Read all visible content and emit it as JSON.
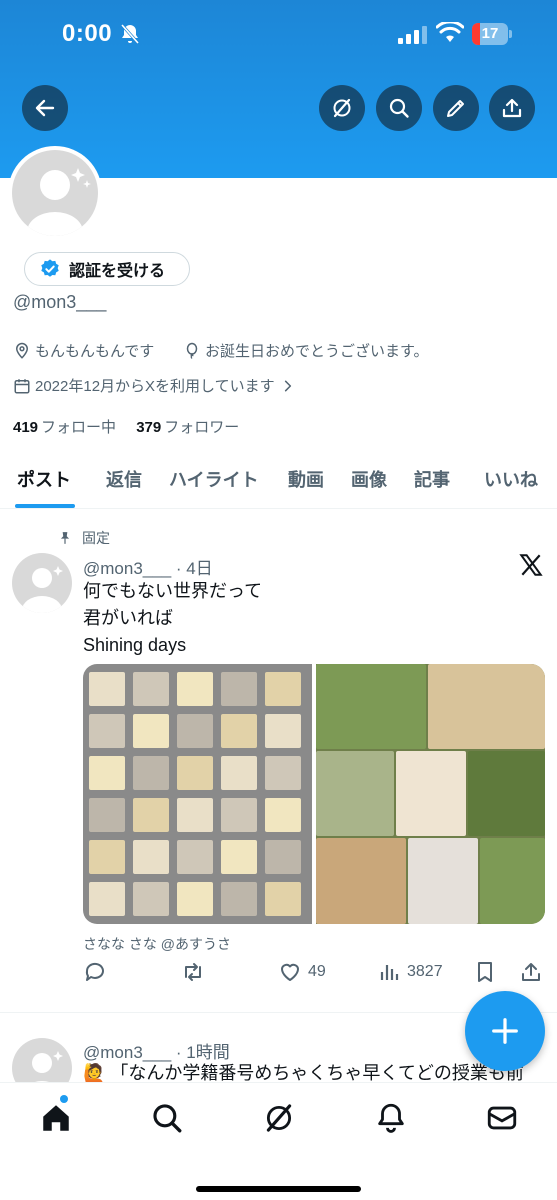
{
  "status_bar": {
    "time": "0:00",
    "battery": "17"
  },
  "profile": {
    "verify_label": "認証を受ける",
    "handle": "@mon3___",
    "bio": "もんもんもんです",
    "location": "お誕生日おめでとうございます。",
    "joined": "2022年12月からXを利用しています",
    "following_count": "419",
    "following_label": "フォロー中",
    "followers_count": "379",
    "followers_label": "フォロワー"
  },
  "tabs": [
    {
      "label": "ポスト"
    },
    {
      "label": "返信"
    },
    {
      "label": "ハイライト"
    },
    {
      "label": "動画"
    },
    {
      "label": "画像"
    },
    {
      "label": "記事"
    },
    {
      "label": "いいね"
    }
  ],
  "pinned_post": {
    "pinned_label": "固定",
    "handle": "@mon3___",
    "time": "· 4日",
    "lines": [
      "何でもない世界だって",
      "君がいれば",
      "Shining days"
    ],
    "media_credit": "さなな さな @あすうさ",
    "likes": "49",
    "views": "3827"
  },
  "second_post": {
    "handle": "@mon3___",
    "time": "· 1時間",
    "text": "🙋 「なんか学籍番号めちゃくちゃ早くてどの授業も前"
  },
  "colors": {
    "accent": "#1d9bf0",
    "banner": "#1d86d6",
    "text": "#0f1419",
    "muted": "#536471"
  },
  "icons": {
    "header": [
      "back-arrow-icon",
      "grok-icon",
      "search-icon",
      "edit-pencil-icon",
      "share-icon"
    ],
    "nav": [
      "home-icon",
      "search-icon",
      "grok-icon",
      "notifications-bell-icon",
      "messages-envelope-icon"
    ]
  }
}
